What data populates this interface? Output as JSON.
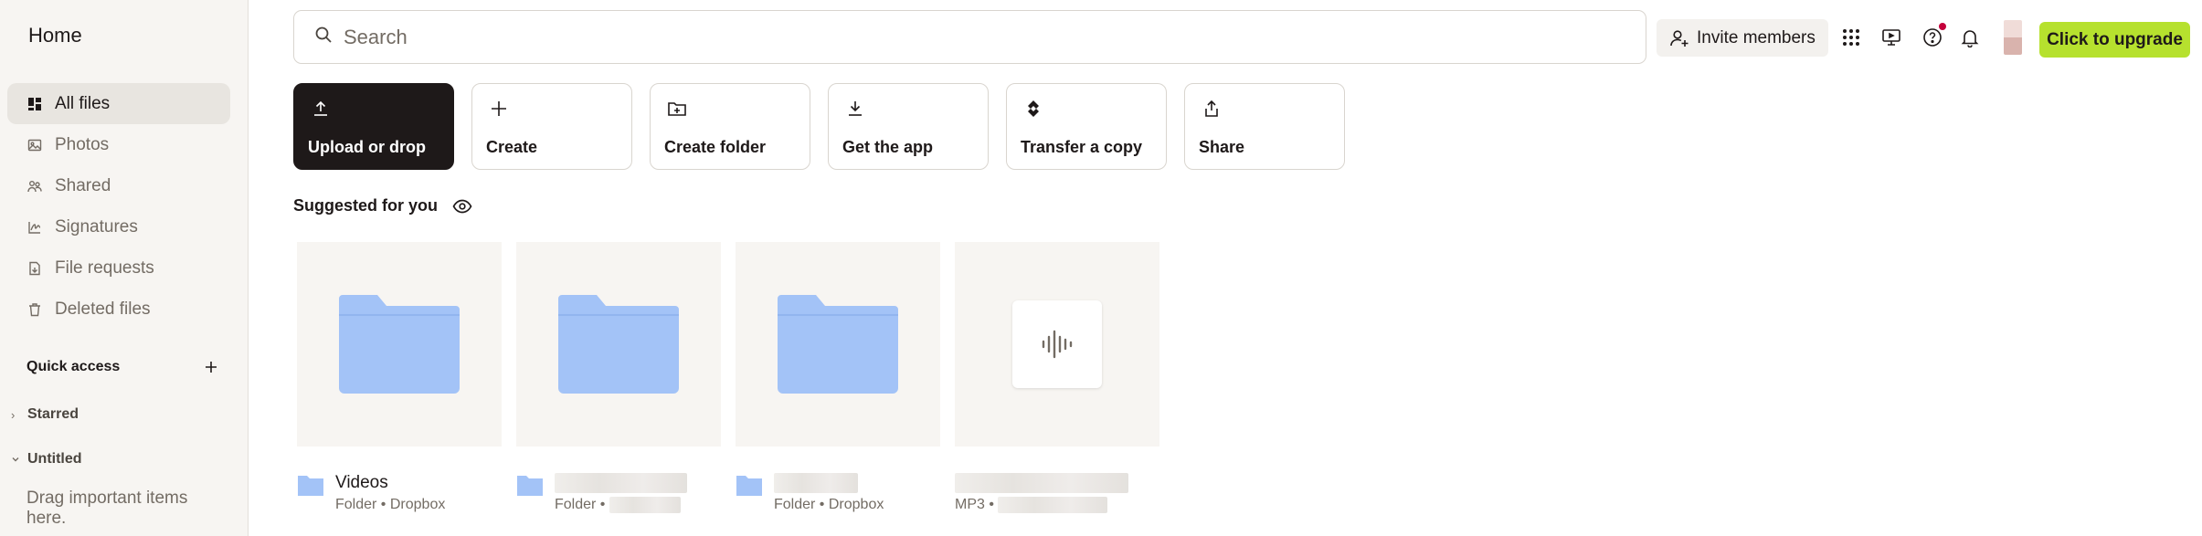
{
  "sidebar": {
    "title": "Home",
    "nav": [
      {
        "label": "All files",
        "icon": "all-files-icon",
        "active": true
      },
      {
        "label": "Photos",
        "icon": "photos-icon"
      },
      {
        "label": "Shared",
        "icon": "shared-icon"
      },
      {
        "label": "Signatures",
        "icon": "signatures-icon"
      },
      {
        "label": "File requests",
        "icon": "file-requests-icon"
      },
      {
        "label": "Deleted files",
        "icon": "trash-icon"
      }
    ],
    "quick_access": {
      "label": "Quick access",
      "add_icon": "plus-icon",
      "sections": [
        {
          "label": "Starred",
          "expanded": false
        },
        {
          "label": "Untitled",
          "expanded": true
        }
      ],
      "hint": "Drag important items here."
    }
  },
  "topbar": {
    "search_placeholder": "Search",
    "invite_label": "Invite members",
    "upgrade_label": "Click to upgrade",
    "icons": [
      "apps-grid-icon",
      "screen-icon",
      "help-icon",
      "bell-icon"
    ]
  },
  "actions": [
    {
      "label": "Upload or drop",
      "icon": "upload-icon",
      "primary": true
    },
    {
      "label": "Create",
      "icon": "plus-icon"
    },
    {
      "label": "Create folder",
      "icon": "create-folder-icon"
    },
    {
      "label": "Get the app",
      "icon": "download-icon"
    },
    {
      "label": "Transfer a copy",
      "icon": "transfer-icon"
    },
    {
      "label": "Share",
      "icon": "share-icon"
    }
  ],
  "suggested": {
    "title": "Suggested for you",
    "items": [
      {
        "name": "Videos",
        "type_label": "Folder",
        "location": "Dropbox",
        "kind": "folder"
      },
      {
        "name": "",
        "type_label": "Folder",
        "location": "",
        "kind": "folder"
      },
      {
        "name": "",
        "type_label": "Folder",
        "location": "Dropbox",
        "kind": "folder"
      },
      {
        "name": "",
        "type_label": "MP3",
        "location": "",
        "kind": "audio"
      }
    ]
  },
  "colors": {
    "accent_upgrade": "#b6e12e",
    "folder_blue": "#a3c3f7",
    "primary_tile": "#1e1919",
    "notification_dot": "#c4003b"
  }
}
